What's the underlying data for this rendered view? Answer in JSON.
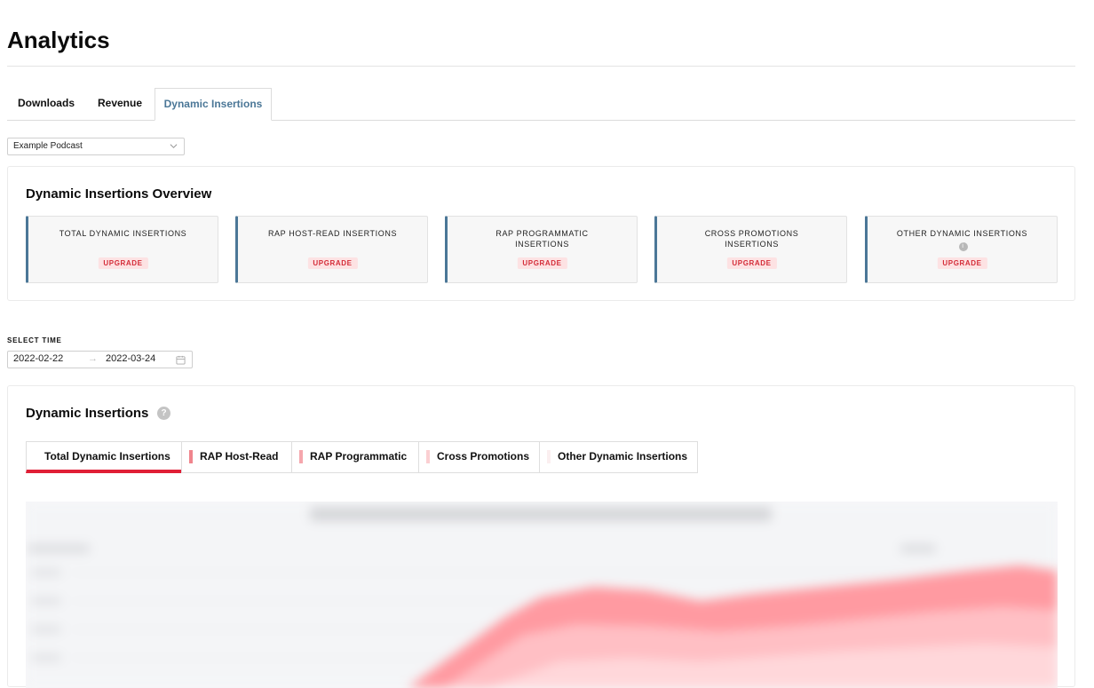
{
  "page": {
    "title": "Analytics"
  },
  "tabs": [
    {
      "label": "Downloads",
      "active": false
    },
    {
      "label": "Revenue",
      "active": false
    },
    {
      "label": "Dynamic Insertions",
      "active": true
    }
  ],
  "podcast_select": {
    "value": "Example Podcast"
  },
  "overview": {
    "title": "Dynamic Insertions Overview",
    "cards": [
      {
        "label": "TOTAL DYNAMIC INSERTIONS",
        "badge": "UPGRADE",
        "info": false
      },
      {
        "label": "RAP HOST-READ INSERTIONS",
        "badge": "UPGRADE",
        "info": false
      },
      {
        "label": "RAP PROGRAMMATIC INSERTIONS",
        "badge": "UPGRADE",
        "info": false
      },
      {
        "label": "CROSS PROMOTIONS INSERTIONS",
        "badge": "UPGRADE",
        "info": false
      },
      {
        "label": "OTHER DYNAMIC INSERTIONS",
        "badge": "UPGRADE",
        "info": true
      }
    ]
  },
  "time": {
    "label": "SELECT TIME",
    "start": "2022-02-22",
    "arrow": "→",
    "end": "2022-03-24"
  },
  "chart_section": {
    "title": "Dynamic Insertions",
    "help": "?",
    "series_tabs": [
      {
        "label": "Total Dynamic Insertions",
        "active": true,
        "color": ""
      },
      {
        "label": "RAP Host-Read",
        "active": false,
        "color": "#f0858d"
      },
      {
        "label": "RAP Programmatic",
        "active": false,
        "color": "#f5a7ad"
      },
      {
        "label": "Cross Promotions",
        "active": false,
        "color": "#fbcfd2"
      },
      {
        "label": "Other Dynamic Insertions",
        "active": false,
        "color": "#fbeff0"
      }
    ]
  },
  "colors": {
    "accent": "#4b7797",
    "brand_red": "#e01f36",
    "badge_bg": "#fde2e3",
    "badge_text": "#d42c38"
  }
}
